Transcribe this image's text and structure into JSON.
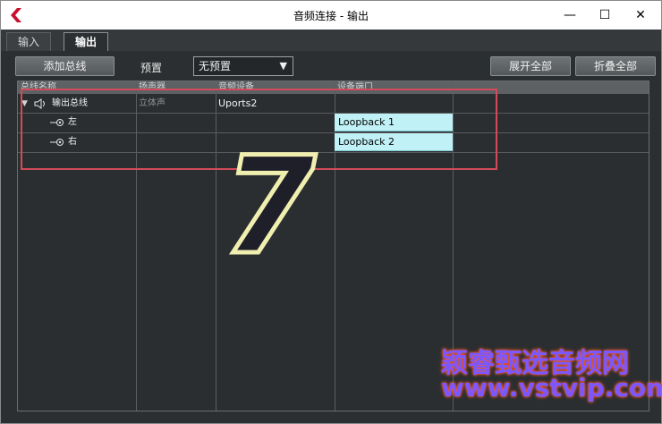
{
  "window": {
    "title": "音频连接 - 输出"
  },
  "tabs": [
    {
      "label": "输入"
    },
    {
      "label": "输出"
    }
  ],
  "toolbar": {
    "add_bus_label": "添加总线",
    "preset_label": "预置",
    "preset_value": "无预置",
    "expand_all_label": "展开全部",
    "collapse_all_label": "折叠全部"
  },
  "columns": [
    "总线名称",
    "扬声器",
    "音频设备",
    "设备端口"
  ],
  "rows": [
    {
      "name": "输出总线",
      "speaker": "立体声",
      "device": "Uports2",
      "port": ""
    },
    {
      "name": "左",
      "speaker": "",
      "device": "",
      "port": "Loopback 1"
    },
    {
      "name": "右",
      "speaker": "",
      "device": "",
      "port": "Loopback 2"
    }
  ],
  "overlay": {
    "number": "7",
    "watermark_line1": "颖睿甄选音频网",
    "watermark_line2": "www.vstvip.com"
  },
  "colors": {
    "accent_port": "#bff1f6",
    "highlight_box": "#d34b59"
  }
}
